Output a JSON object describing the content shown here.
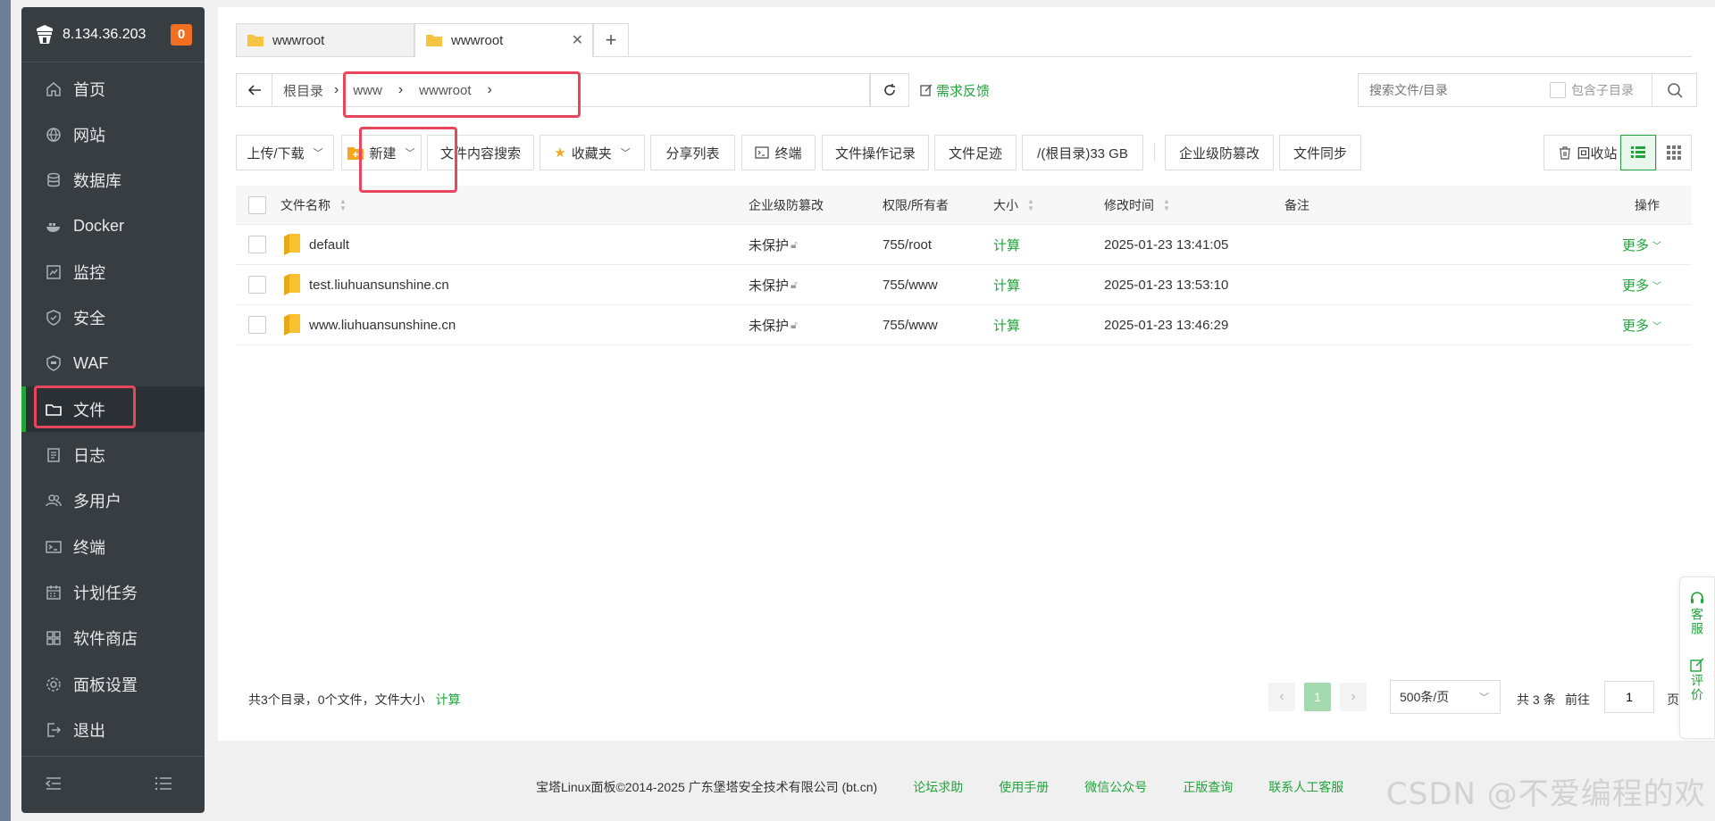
{
  "sidebar": {
    "ip": "8.134.36.203",
    "badge": "0",
    "items": [
      {
        "label": "首页",
        "icon": "home-icon"
      },
      {
        "label": "网站",
        "icon": "globe-icon"
      },
      {
        "label": "数据库",
        "icon": "database-icon"
      },
      {
        "label": "Docker",
        "icon": "docker-icon"
      },
      {
        "label": "监控",
        "icon": "monitor-icon"
      },
      {
        "label": "安全",
        "icon": "shield-icon"
      },
      {
        "label": "WAF",
        "icon": "waf-icon"
      },
      {
        "label": "文件",
        "icon": "folder-icon",
        "active": true
      },
      {
        "label": "日志",
        "icon": "log-icon"
      },
      {
        "label": "多用户",
        "icon": "users-icon"
      },
      {
        "label": "终端",
        "icon": "terminal-icon"
      },
      {
        "label": "计划任务",
        "icon": "calendar-icon"
      },
      {
        "label": "软件商店",
        "icon": "grid-icon"
      },
      {
        "label": "面板设置",
        "icon": "gear-icon"
      },
      {
        "label": "退出",
        "icon": "logout-icon"
      }
    ]
  },
  "tabs": [
    {
      "label": "wwwroot",
      "active": false
    },
    {
      "label": "wwwroot",
      "active": true
    }
  ],
  "path": {
    "crumbs": [
      "根目录",
      "www",
      "wwwroot"
    ],
    "feedback": "需求反馈"
  },
  "search": {
    "placeholder": "搜索文件/目录",
    "include_sub": "包含子目录"
  },
  "toolbar": {
    "upload": "上传/下载",
    "new": "新建",
    "content_search": "文件内容搜索",
    "favorites": "收藏夹",
    "share_list": "分享列表",
    "terminal": "终端",
    "op_log": "文件操作记录",
    "footprint": "文件足迹",
    "disk": "/(根目录)33 GB",
    "tamper": "企业级防篡改",
    "sync": "文件同步",
    "recycle": "回收站"
  },
  "table": {
    "headers": {
      "name": "文件名称",
      "protect": "企业级防篡改",
      "perm": "权限/所有者",
      "size": "大小",
      "mtime": "修改时间",
      "note": "备注",
      "ops": "操作"
    },
    "rows": [
      {
        "name": "default",
        "protect": "未保护",
        "perm": "755/root",
        "size": "计算",
        "mtime": "2025-01-23 13:41:05",
        "more": "更多"
      },
      {
        "name": "test.liuhuansunshine.cn",
        "protect": "未保护",
        "perm": "755/www",
        "size": "计算",
        "mtime": "2025-01-23 13:53:10",
        "more": "更多"
      },
      {
        "name": "www.liuhuansunshine.cn",
        "protect": "未保护",
        "perm": "755/www",
        "size": "计算",
        "mtime": "2025-01-23 13:46:29",
        "more": "更多"
      }
    ]
  },
  "footer_info": {
    "summary": "共3个目录，0个文件，文件大小",
    "calc": "计算"
  },
  "pager": {
    "current": "1",
    "page_size": "500条/页",
    "total": "共 3 条",
    "goto": "前往",
    "goto_value": "1",
    "page_unit": "页"
  },
  "site_footer": {
    "copyright": "宝塔Linux面板©2014-2025 广东堡塔安全技术有限公司 (bt.cn)",
    "links": [
      "论坛求助",
      "使用手册",
      "微信公众号",
      "正版查询",
      "联系人工客服"
    ]
  },
  "float": {
    "service": "客服",
    "rate": "评价"
  },
  "watermark": "CSDN @不爱编程的欢",
  "colors": {
    "accent": "#20a53a",
    "sidebar_bg": "#373d41",
    "highlight": "#e8465c",
    "badge": "#f26f21"
  }
}
